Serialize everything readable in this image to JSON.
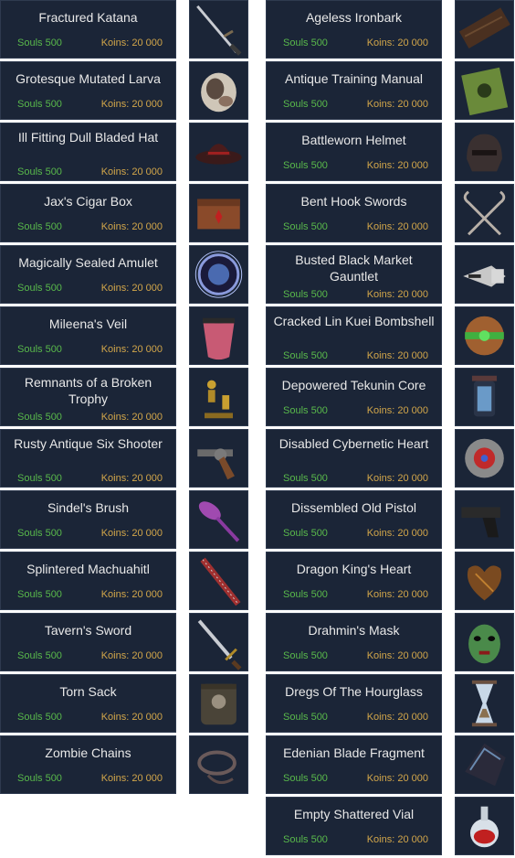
{
  "left_items": [
    {
      "name": "Fractured Katana",
      "koins": "Koins: 20 000",
      "souls": "Souls 500",
      "icon": "katana-icon"
    },
    {
      "name": "Grotesque Mutated Larva",
      "koins": "Koins: 20 000",
      "souls": "Souls 500",
      "icon": "larva-icon"
    },
    {
      "name": "Ill Fitting Dull Bladed Hat",
      "koins": "Koins: 20 000",
      "souls": "Souls 500",
      "icon": "hat-icon"
    },
    {
      "name": "Jax's Cigar Box",
      "koins": "Koins: 20 000",
      "souls": "Souls 500",
      "icon": "cigar-box-icon"
    },
    {
      "name": "Magically Sealed Amulet",
      "koins": "Koins: 20 000",
      "souls": "Souls 500",
      "icon": "amulet-icon"
    },
    {
      "name": "Mileena's Veil",
      "koins": "Koins: 20 000",
      "souls": "Souls 500",
      "icon": "veil-icon"
    },
    {
      "name": "Remnants of a Broken Trophy",
      "koins": "Koins: 20 000",
      "souls": "Souls 500",
      "icon": "trophy-icon"
    },
    {
      "name": "Rusty Antique Six Shooter",
      "koins": "Koins: 20 000",
      "souls": "Souls 500",
      "icon": "revolver-icon"
    },
    {
      "name": "Sindel's Brush",
      "koins": "Koins: 20 000",
      "souls": "Souls 500",
      "icon": "brush-icon"
    },
    {
      "name": "Splintered Machuahitl",
      "koins": "Koins: 20 000",
      "souls": "Souls 500",
      "icon": "club-icon"
    },
    {
      "name": "Tavern's Sword",
      "koins": "Koins: 20 000",
      "souls": "Souls 500",
      "icon": "sword-icon"
    },
    {
      "name": "Torn Sack",
      "koins": "Koins: 20 000",
      "souls": "Souls 500",
      "icon": "sack-icon"
    },
    {
      "name": "Zombie Chains",
      "koins": "Koins: 20 000",
      "souls": "Souls 500",
      "icon": "chains-icon"
    }
  ],
  "right_items": [
    {
      "name": "Ageless Ironbark",
      "koins": "Koins: 20 000",
      "souls": "Souls 500",
      "icon": "ironbark-icon"
    },
    {
      "name": "Antique Training Manual",
      "koins": "Koins: 20 000",
      "souls": "Souls 500",
      "icon": "manual-icon"
    },
    {
      "name": "Battleworn Helmet",
      "koins": "Koins: 20 000",
      "souls": "Souls 500",
      "icon": "helmet-icon"
    },
    {
      "name": "Bent Hook Swords",
      "koins": "Koins: 20 000",
      "souls": "Souls 500",
      "icon": "hook-swords-icon"
    },
    {
      "name": "Busted Black Market Gauntlet",
      "koins": "Koins: 20 000",
      "souls": "Souls 500",
      "icon": "gauntlet-icon"
    },
    {
      "name": "Cracked Lin Kuei Bombshell",
      "koins": "Koins: 20 000",
      "souls": "Souls 500",
      "icon": "bombshell-icon"
    },
    {
      "name": "Depowered Tekunin Core",
      "koins": "Koins: 20 000",
      "souls": "Souls 500",
      "icon": "core-icon"
    },
    {
      "name": "Disabled Cybernetic Heart",
      "koins": "Koins: 20 000",
      "souls": "Souls 500",
      "icon": "cyber-heart-icon"
    },
    {
      "name": "Dissembled Old Pistol",
      "koins": "Koins: 20 000",
      "souls": "Souls 500",
      "icon": "pistol-icon"
    },
    {
      "name": "Dragon King's Heart",
      "koins": "Koins: 20 000",
      "souls": "Souls 500",
      "icon": "dragon-heart-icon"
    },
    {
      "name": "Drahmin's Mask",
      "koins": "Koins: 20 000",
      "souls": "Souls 500",
      "icon": "mask-icon"
    },
    {
      "name": "Dregs Of The Hourglass",
      "koins": "Koins: 20 000",
      "souls": "Souls 500",
      "icon": "hourglass-icon"
    },
    {
      "name": "Edenian Blade Fragment",
      "koins": "Koins: 20 000",
      "souls": "Souls 500",
      "icon": "blade-fragment-icon"
    },
    {
      "name": "Empty Shattered Vial",
      "koins": "Koins: 20 000",
      "souls": "Souls 500",
      "icon": "vial-icon"
    }
  ],
  "colors": {
    "panel_bg": "#1b2537",
    "name_text": "#e8e8e8",
    "koins_text": "#d2a64a",
    "souls_text": "#59b94b"
  }
}
